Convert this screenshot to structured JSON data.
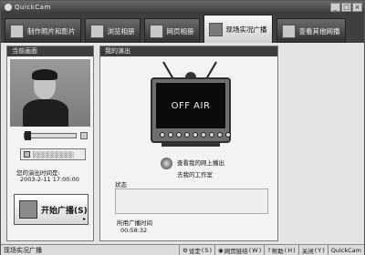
{
  "window": {
    "title": "QuickCam",
    "controls": [
      "_",
      "□",
      "×"
    ]
  },
  "tabs": [
    {
      "label": "制作照片和影片",
      "active": false
    },
    {
      "label": "浏览相册",
      "active": false
    },
    {
      "label": "网页相册",
      "active": false
    },
    {
      "label": "现场实况广播",
      "active": true
    },
    {
      "label": "查看其他网播",
      "active": false
    }
  ],
  "left_panel": {
    "header": "当前画面",
    "slider_level": 0.05,
    "schedule_button": "░░░░░░░░░",
    "schedule_label": "您的演出时间是:",
    "schedule_value": "2003-2-11 17:00:00",
    "start_button": "开始广播(S)"
  },
  "right_panel": {
    "header": "我的演出",
    "tv_text": "OFF AIR",
    "link_line1": "查看我的网上播出",
    "link_line2": "去我的工作室",
    "status_label": "状态",
    "status_value": "",
    "time_label": "所用广播时间",
    "time_value": "00:58:32"
  },
  "status_bar": {
    "left": "现场实况广播",
    "buttons": [
      {
        "label": "设定",
        "key": "S"
      },
      {
        "label": "网页链结",
        "key": "W"
      },
      {
        "label": "帮助",
        "key": "H"
      },
      {
        "label": "关闭",
        "key": "Y"
      },
      {
        "label": "QuickCam",
        "key": ""
      }
    ]
  },
  "colors": {
    "titlebar": "#3a3a3a",
    "panel_header": "#3d3d3d",
    "background": "#e4e4e4"
  }
}
